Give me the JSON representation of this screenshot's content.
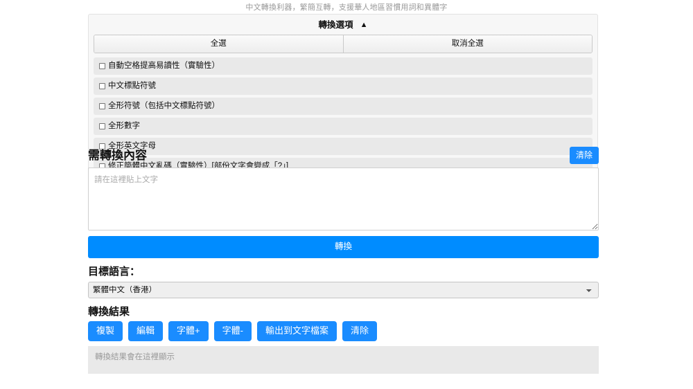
{
  "header": {
    "subtitle": "中文轉換利器，繁簡互轉，支援華人地區習慣用詞和異體字"
  },
  "options_panel": {
    "title": "轉換選項",
    "toggle_icon": "▲",
    "select_all_label": "全選",
    "deselect_all_label": "取消全選",
    "items": [
      {
        "label": "自動空格提高易讀性（實驗性）",
        "checked": false
      },
      {
        "label": "中文標點符號",
        "checked": false
      },
      {
        "label": "全形符號（包括中文標點符號）",
        "checked": false
      },
      {
        "label": "全形數字",
        "checked": false
      },
      {
        "label": "全形英文字母",
        "checked": false
      },
      {
        "label": "修正簡體中文亂碼（實驗性）[部份文字會變成「?」]",
        "checked": false
      }
    ]
  },
  "input_section": {
    "title": "需轉換內容",
    "clear_label": "清除",
    "textarea_value": "",
    "textarea_placeholder": "請在這裡貼上文字"
  },
  "convert": {
    "label": "轉換"
  },
  "language_section": {
    "label": "目標語言：",
    "selected": "繁體中文（香港）",
    "options": [
      "繁體中文（香港）"
    ]
  },
  "result_section": {
    "title": "轉換結果",
    "buttons": [
      {
        "label": "複製"
      },
      {
        "label": "編輯"
      },
      {
        "label": "字體+"
      },
      {
        "label": "字體-"
      },
      {
        "label": "輸出到文字檔案"
      },
      {
        "label": "清除"
      }
    ],
    "placeholder": "轉換結果會在這裡顯示"
  },
  "colors": {
    "accent_blue": "#1a8cff",
    "convert_blue": "#008cff",
    "panel_bg": "#f7f7f7",
    "row_bg": "#e9e9e9",
    "result_bg": "#e9e9e9",
    "muted_text": "#999999"
  }
}
